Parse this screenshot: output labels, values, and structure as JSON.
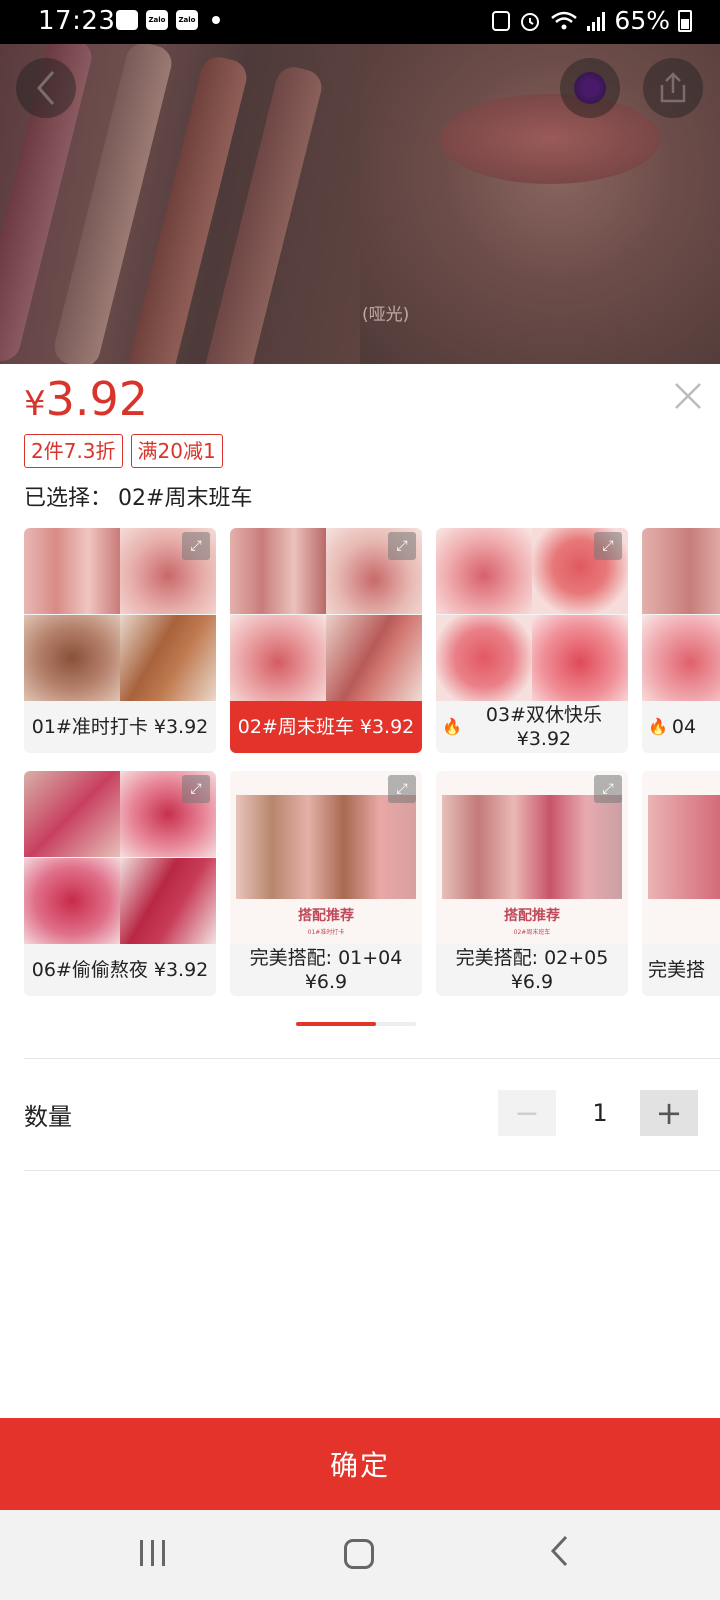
{
  "status_bar": {
    "time": "17:23",
    "left_icons": [
      "gallery-icon",
      "zalo-icon",
      "zalo-icon",
      "notification-dot-icon"
    ],
    "battery": "65%"
  },
  "hero": {
    "caption": "(哑光)"
  },
  "panel": {
    "price_symbol": "¥",
    "price": "3.92",
    "promos": [
      "2件7.3折",
      "满20减1"
    ],
    "selected_label": "已选择：",
    "selected_value": "02#周末班车",
    "options": [
      {
        "label": "01#准时打卡 ¥3.92",
        "selected": false,
        "hot": false
      },
      {
        "label": "02#周末班车 ¥3.92",
        "selected": true,
        "hot": false
      },
      {
        "label": "03#双休快乐 ¥3.92",
        "selected": false,
        "hot": true
      },
      {
        "label": "04",
        "selected": false,
        "hot": true
      },
      {
        "label": "06#偷偷熬夜 ¥3.92",
        "selected": false,
        "hot": false
      },
      {
        "label": "完美搭配: 01+04 ¥6.9",
        "selected": false,
        "hot": false,
        "combo_title": "搭配推荐",
        "combo_sub": "01#准时打卡"
      },
      {
        "label": "完美搭配: 02+05 ¥6.9",
        "selected": false,
        "hot": false,
        "combo_title": "搭配推荐",
        "combo_sub": "02#周末班车"
      },
      {
        "label": "完美搭",
        "selected": false,
        "hot": false
      }
    ],
    "quantity_label": "数量",
    "quantity": "1",
    "minus": "−",
    "plus": "+",
    "confirm": "确定"
  },
  "colors": {
    "accent": "#e3332a",
    "price": "#d9342b"
  }
}
